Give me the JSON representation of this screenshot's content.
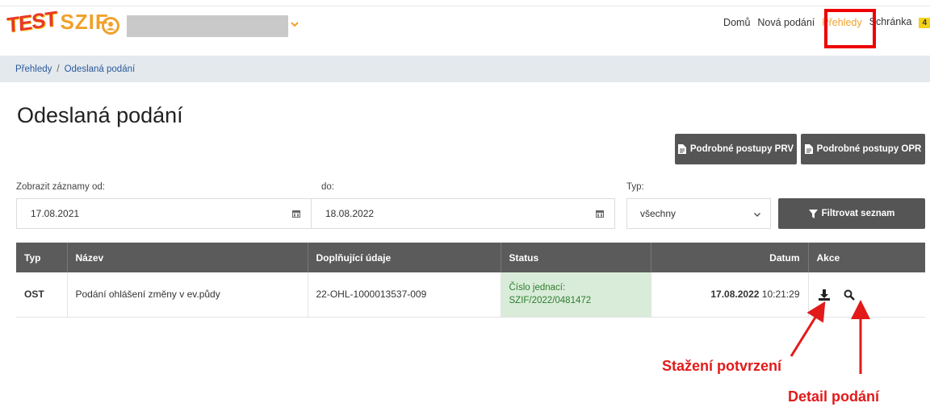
{
  "header": {
    "logo_test": "TEST",
    "logo_name": "SZIF",
    "nav": {
      "home": "Domů",
      "new_submission": "Nová podání",
      "overviews": "Přehledy",
      "inbox": "Schránka",
      "inbox_count": "4"
    },
    "colors": {
      "accent": "#f0a12c",
      "highlight": "#ee0000"
    }
  },
  "breadcrumb": {
    "root": "Přehledy",
    "separator": "/",
    "current": "Odeslaná podání"
  },
  "page_title": "Odeslaná podání",
  "buttons": {
    "prv": "Podrobné postupy PRV",
    "opr": "Podrobné postupy OPR",
    "filter": "Filtrovat seznam"
  },
  "filters": {
    "from_label": "Zobrazit záznamy od:",
    "from_value": "17.08.2021",
    "to_label": "do:",
    "to_value": "18.08.2022",
    "type_label": "Typ:",
    "type_value": "všechny"
  },
  "table": {
    "headers": [
      "Typ",
      "Název",
      "Doplňující údaje",
      "Status",
      "Datum",
      "Akce"
    ],
    "rows": [
      {
        "type": "OST",
        "name": "Podání ohlášení změny v ev.půdy",
        "extra": "22-OHL-1000013537-009",
        "status_line1": "Číslo jednací:",
        "status_line2": "SZIF/2022/0481472",
        "date": "17.08.2022",
        "time": "10:21:29"
      }
    ]
  },
  "annotations": {
    "download": "Stažení potvrzení",
    "detail": "Detail podání"
  }
}
